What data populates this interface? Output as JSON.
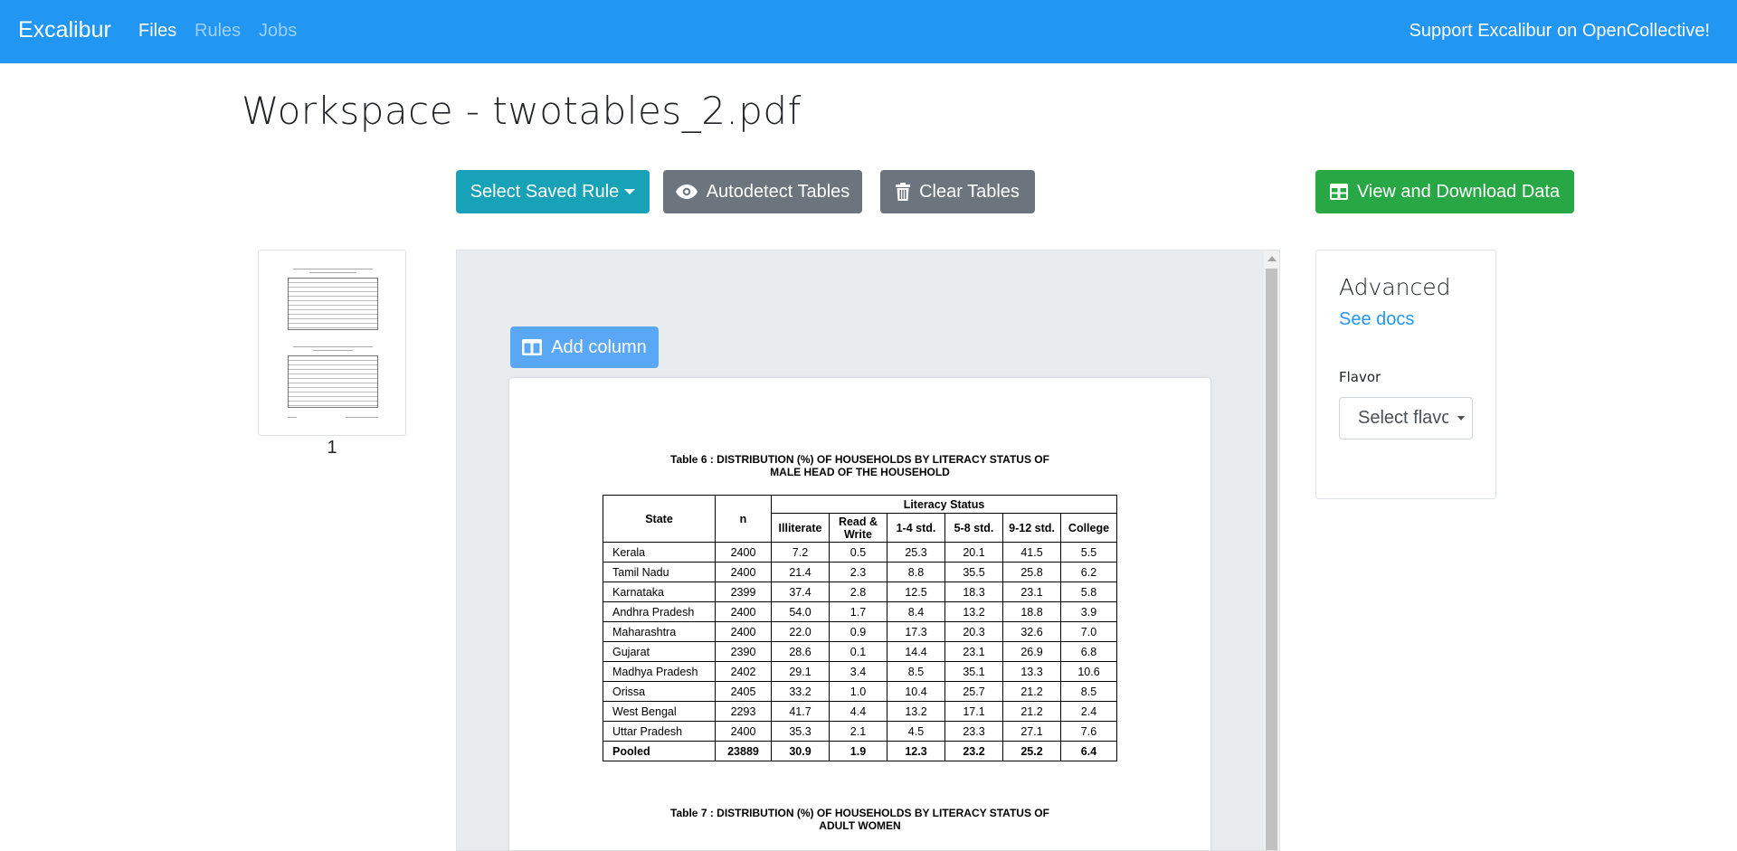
{
  "navbar": {
    "brand": "Excalibur",
    "links": [
      "Files",
      "Rules",
      "Jobs"
    ],
    "support": "Support Excalibur on OpenCollective!"
  },
  "page": {
    "title": "Workspace - twotables_2.pdf"
  },
  "toolbar": {
    "select_rule": "Select Saved Rule",
    "autodetect": "Autodetect Tables",
    "clear": "Clear Tables",
    "download": "View and Download Data"
  },
  "thumbnail": {
    "page_number": "1"
  },
  "viewer": {
    "add_column": "Add column"
  },
  "document": {
    "table6_title_line1": "Table 6 : DISTRIBUTION (%) OF HOUSEHOLDS BY LITERACY STATUS OF",
    "table6_title_line2": "MALE HEAD OF THE HOUSEHOLD",
    "table7_title_line1": "Table 7 : DISTRIBUTION (%) OF HOUSEHOLDS BY LITERACY STATUS OF",
    "table7_title_line2": "ADULT WOMEN",
    "headers": {
      "state": "State",
      "n": "n",
      "group": "Literacy Status",
      "cols": [
        "Illiterate",
        "Read & Write",
        "1-4 std.",
        "5-8 std.",
        "9-12 std.",
        "College"
      ]
    },
    "rows": [
      [
        "Kerala",
        "2400",
        "7.2",
        "0.5",
        "25.3",
        "20.1",
        "41.5",
        "5.5"
      ],
      [
        "Tamil Nadu",
        "2400",
        "21.4",
        "2.3",
        "8.8",
        "35.5",
        "25.8",
        "6.2"
      ],
      [
        "Karnataka",
        "2399",
        "37.4",
        "2.8",
        "12.5",
        "18.3",
        "23.1",
        "5.8"
      ],
      [
        "Andhra Pradesh",
        "2400",
        "54.0",
        "1.7",
        "8.4",
        "13.2",
        "18.8",
        "3.9"
      ],
      [
        "Maharashtra",
        "2400",
        "22.0",
        "0.9",
        "17.3",
        "20.3",
        "32.6",
        "7.0"
      ],
      [
        "Gujarat",
        "2390",
        "28.6",
        "0.1",
        "14.4",
        "23.1",
        "26.9",
        "6.8"
      ],
      [
        "Madhya Pradesh",
        "2402",
        "29.1",
        "3.4",
        "8.5",
        "35.1",
        "13.3",
        "10.6"
      ],
      [
        "Orissa",
        "2405",
        "33.2",
        "1.0",
        "10.4",
        "25.7",
        "21.2",
        "8.5"
      ],
      [
        "West Bengal",
        "2293",
        "41.7",
        "4.4",
        "13.2",
        "17.1",
        "21.2",
        "2.4"
      ],
      [
        "Uttar Pradesh",
        "2400",
        "35.3",
        "2.1",
        "4.5",
        "23.3",
        "27.1",
        "7.6"
      ]
    ],
    "pooled": [
      "Pooled",
      "23889",
      "30.9",
      "1.9",
      "12.3",
      "23.2",
      "25.2",
      "6.4"
    ]
  },
  "advanced": {
    "title": "Advanced",
    "docs_link": "See docs",
    "flavor_label": "Flavor",
    "flavor_value": "Select flavor"
  }
}
